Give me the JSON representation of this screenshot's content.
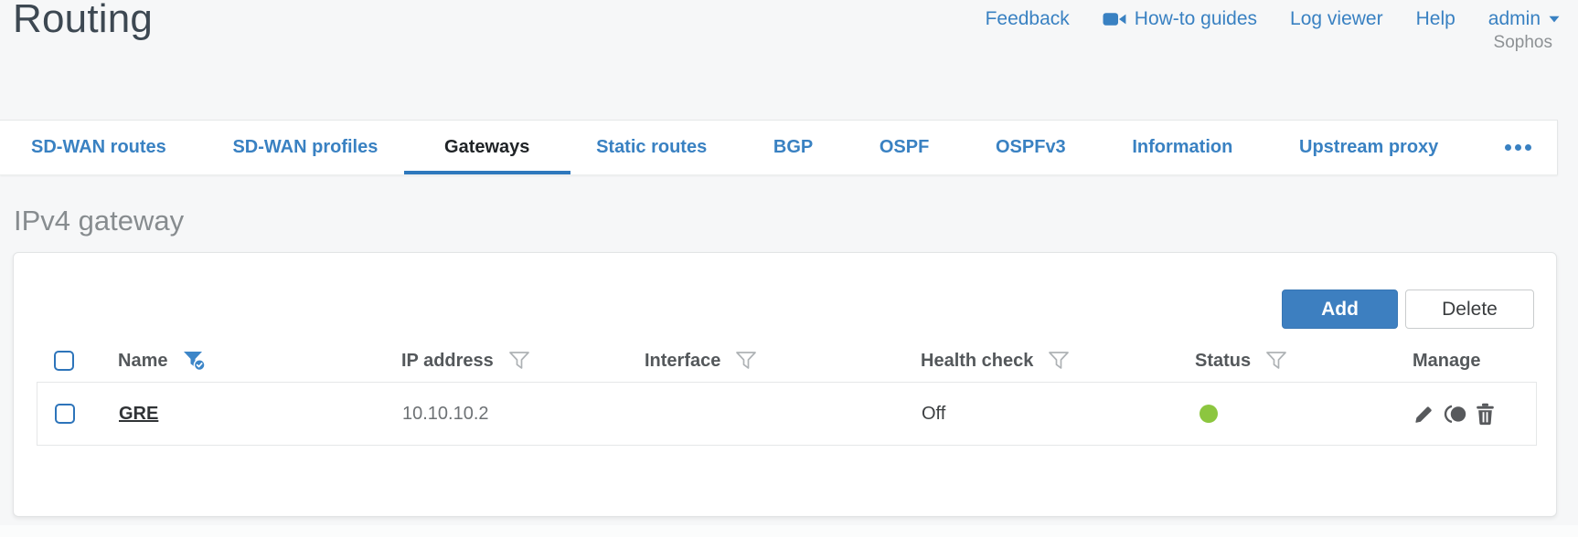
{
  "header": {
    "title": "Routing",
    "nav": [
      {
        "label": "Feedback"
      },
      {
        "label": "How-to guides",
        "icon": "videocam-icon"
      },
      {
        "label": "Log viewer"
      },
      {
        "label": "Help"
      },
      {
        "label": "admin",
        "icon": "caret-down-icon"
      }
    ],
    "brand": "Sophos"
  },
  "tabs": {
    "items": [
      {
        "label": "SD-WAN routes",
        "active": false
      },
      {
        "label": "SD-WAN profiles",
        "active": false
      },
      {
        "label": "Gateways",
        "active": true
      },
      {
        "label": "Static routes",
        "active": false
      },
      {
        "label": "BGP",
        "active": false
      },
      {
        "label": "OSPF",
        "active": false
      },
      {
        "label": "OSPFv3",
        "active": false
      },
      {
        "label": "Information",
        "active": false
      },
      {
        "label": "Upstream proxy",
        "active": false
      }
    ],
    "overflow_icon": "ellipsis-icon"
  },
  "section": {
    "title": "IPv4 gateway"
  },
  "toolbar": {
    "add_label": "Add",
    "delete_label": "Delete"
  },
  "table": {
    "columns": [
      {
        "label": "Name",
        "filter": "active"
      },
      {
        "label": "IP address",
        "filter": "default"
      },
      {
        "label": "Interface",
        "filter": "default"
      },
      {
        "label": "Health check",
        "filter": "default"
      },
      {
        "label": "Status",
        "filter": "default"
      },
      {
        "label": "Manage",
        "filter": "none"
      }
    ],
    "rows": [
      {
        "name": "GRE",
        "ip_address": "10.10.10.2",
        "interface": "",
        "health_check": "Off",
        "status": "up",
        "manage_icons": [
          "edit-icon",
          "clone-icon",
          "delete-icon"
        ]
      }
    ]
  },
  "colors": {
    "accent_blue": "#3981c2",
    "add_button_blue": "#3d7fc0",
    "active_tab_underline": "#2e78bd",
    "status_up_green": "#8cc63f",
    "checkbox_border": "#2d74ba",
    "title_gray": "#878c8f"
  }
}
